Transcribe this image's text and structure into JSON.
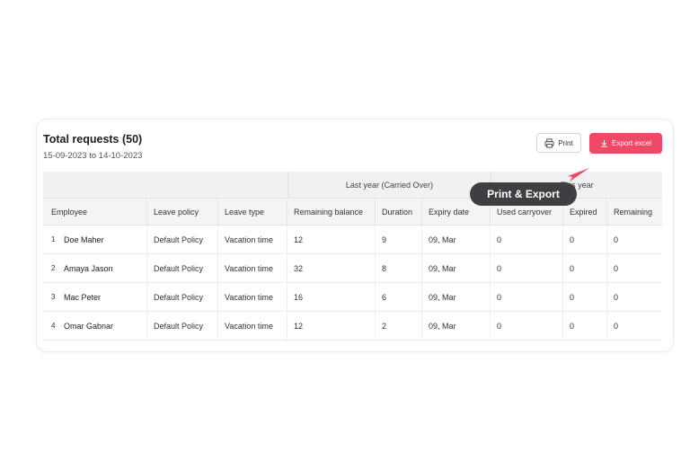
{
  "header": {
    "title": "Total requests (50)",
    "date_range": "15-09-2023 to 14-10-2023",
    "print_label": "Print",
    "export_label": "Export excel"
  },
  "table": {
    "groups": {
      "last_year": "Last year (Carried Over)",
      "this_year": "This year"
    },
    "columns": [
      "Employee",
      "Leave policy",
      "Leave type",
      "Remaining balance",
      "Duration",
      "Expiry date",
      "Used carryover",
      "Expired",
      "Remaining"
    ],
    "rows": [
      {
        "index": "1",
        "employee": "Doe Maher",
        "policy": "Default Policy",
        "type": "Vacation time",
        "remaining_balance": "12",
        "duration": "9",
        "expiry": "09, Mar",
        "used": "0",
        "expired": "0",
        "remaining": "0"
      },
      {
        "index": "2",
        "employee": "Amaya Jason",
        "policy": "Default Policy",
        "type": "Vacation time",
        "remaining_balance": "32",
        "duration": "8",
        "expiry": "09, Mar",
        "used": "0",
        "expired": "0",
        "remaining": "0"
      },
      {
        "index": "3",
        "employee": "Mac Peter",
        "policy": "Default Policy",
        "type": "Vacation time",
        "remaining_balance": "16",
        "duration": "6",
        "expiry": "09, Mar",
        "used": "0",
        "expired": "0",
        "remaining": "0"
      },
      {
        "index": "4",
        "employee": "Omar Gabnar",
        "policy": "Default Policy",
        "type": "Vacation time",
        "remaining_balance": "12",
        "duration": "2",
        "expiry": "09, Mar",
        "used": "0",
        "expired": "0",
        "remaining": "0"
      }
    ]
  },
  "tooltip": {
    "label": "Print & Export"
  },
  "icons": {
    "print": "printer-icon",
    "export": "download-icon",
    "cursor": "pointer-cursor-icon"
  },
  "colors": {
    "accent": "#f04967",
    "tooltip_bg": "#3f3f43"
  }
}
